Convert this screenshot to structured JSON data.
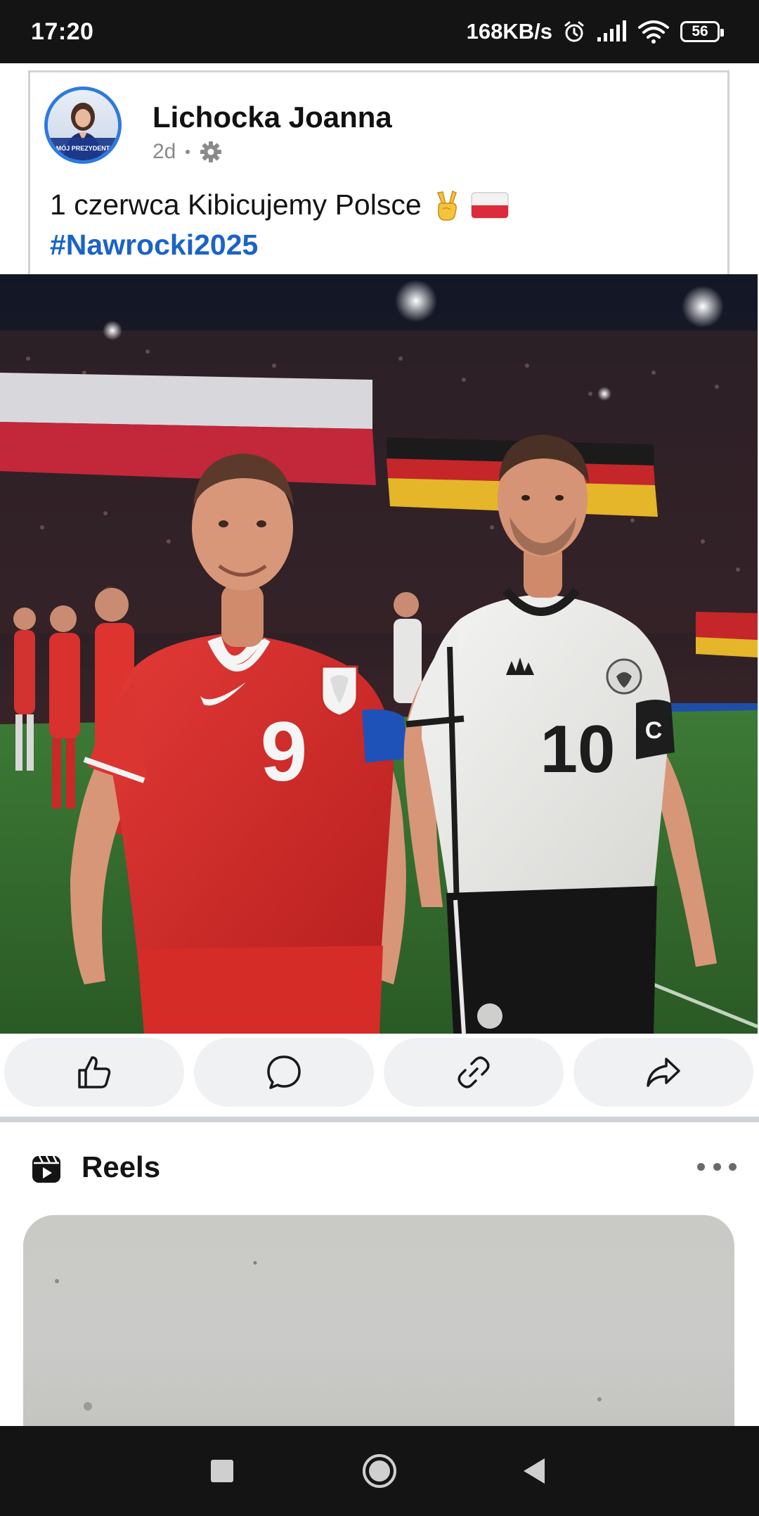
{
  "status_bar": {
    "time": "17:20",
    "net_speed": "168KB/s",
    "battery": "56",
    "icons": [
      "alarm-icon",
      "signal-icon",
      "wifi-icon",
      "battery-icon"
    ]
  },
  "post": {
    "author": "Lichocka Joanna",
    "age": "2d",
    "privacy_icon": "gear-icon",
    "text_line1": "1 czerwca Kibicujemy Polsce",
    "emoji": "victory-hand, poland-flag",
    "hashtag": "#Nawrocki2025",
    "avatar_badge": "MÓJ PREZYDENT",
    "photo_left_jersey_number": "9",
    "photo_right_jersey_number": "10"
  },
  "actions": [
    {
      "name": "like-button",
      "icon": "thumbs-up-icon"
    },
    {
      "name": "comment-button",
      "icon": "comment-icon"
    },
    {
      "name": "copy-link-button",
      "icon": "link-icon"
    },
    {
      "name": "share-button",
      "icon": "share-icon"
    }
  ],
  "reels": {
    "title": "Reels",
    "icon": "reels-icon",
    "more_icon": "more-dots-icon"
  },
  "nav": {
    "icons": [
      "recents-square-icon",
      "home-circle-icon",
      "back-triangle-icon"
    ]
  },
  "colors": {
    "hashtag": "#1b63c6",
    "avatar_ring": "#2d7ae0",
    "status_bar": "#141414",
    "action_bg": "#f0f1f3"
  }
}
